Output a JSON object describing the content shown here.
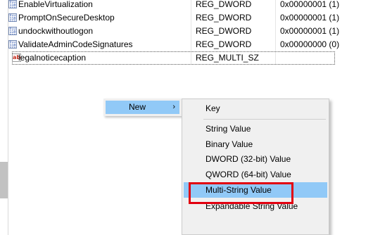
{
  "values": [
    {
      "name": "EnableVirtualization",
      "type": "REG_DWORD",
      "data": "0x00000001 (1)",
      "icon": "binary-value-icon"
    },
    {
      "name": "PromptOnSecureDesktop",
      "type": "REG_DWORD",
      "data": "0x00000001 (1)",
      "icon": "binary-value-icon"
    },
    {
      "name": "undockwithoutlogon",
      "type": "REG_DWORD",
      "data": "0x00000001 (1)",
      "icon": "binary-value-icon"
    },
    {
      "name": "ValidateAdminCodeSignatures",
      "type": "REG_DWORD",
      "data": "0x00000000 (0)",
      "icon": "binary-value-icon"
    },
    {
      "name": "legalnoticecaption",
      "type": "REG_MULTI_SZ",
      "data": "",
      "icon": "string-value-icon"
    }
  ],
  "icons": {
    "binary_glyph": "011\n110\n010",
    "string_glyph": "ab"
  },
  "context_menu": {
    "new_label": "New",
    "new_arrow": "›"
  },
  "new_submenu": {
    "key_label": "Key",
    "string_label": "String Value",
    "binary_label": "Binary Value",
    "dword_label": "DWORD (32-bit) Value",
    "qword_label": "QWORD (64-bit) Value",
    "multistring_label": "Multi-String Value",
    "expandable_label": "Expandable String Value"
  },
  "colors": {
    "menu_highlight": "#91c9f7",
    "annotation_box": "#e2000f"
  }
}
